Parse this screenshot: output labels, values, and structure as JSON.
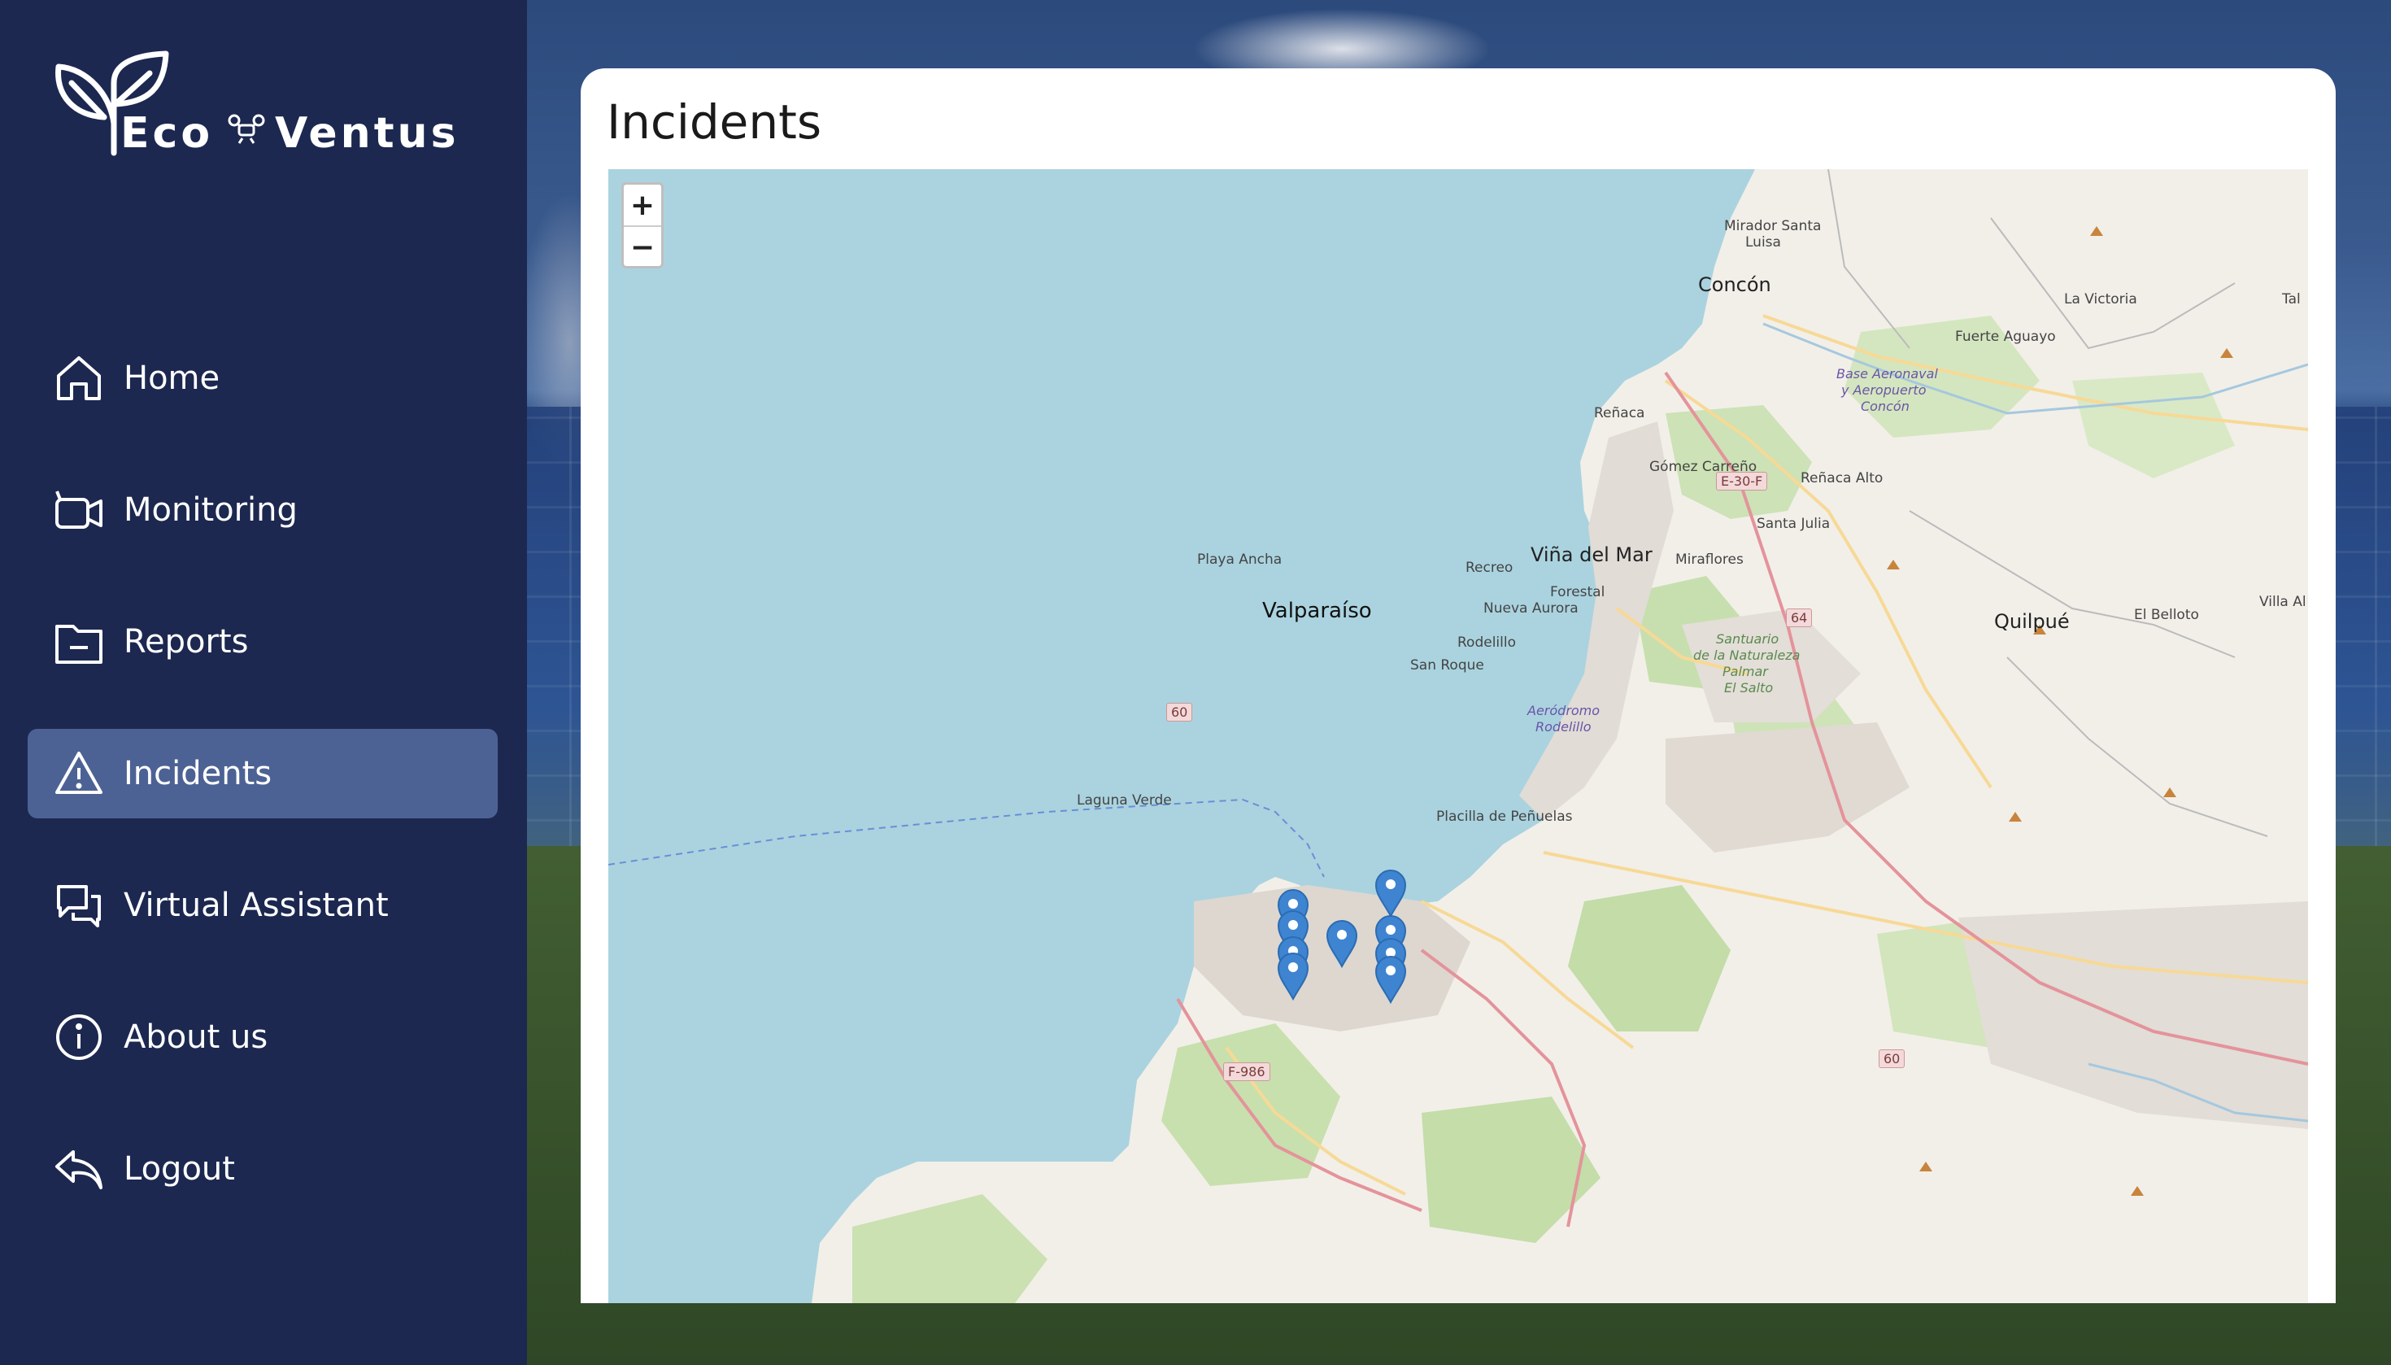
{
  "app": {
    "logo_text_1": "Eco",
    "logo_text_2": "Ventus",
    "accent": "#4d6294",
    "sidebar_bg": "#1c2850"
  },
  "sidebar": {
    "items": [
      {
        "label": "Home",
        "icon": "home-icon",
        "active": false
      },
      {
        "label": "Monitoring",
        "icon": "video-camera-icon",
        "active": false
      },
      {
        "label": "Reports",
        "icon": "folder-icon",
        "active": false
      },
      {
        "label": "Incidents",
        "icon": "warning-icon",
        "active": true
      },
      {
        "label": "Virtual Assistant",
        "icon": "chat-icon",
        "active": false
      },
      {
        "label": "About us",
        "icon": "info-icon",
        "active": false
      },
      {
        "label": "Logout",
        "icon": "logout-icon",
        "active": false
      }
    ]
  },
  "main": {
    "title": "Incidents",
    "map": {
      "zoom_in": "+",
      "zoom_out": "−",
      "labels": {
        "mirador": "Mirador Santa",
        "mirador2": "Luisa",
        "concon": "Concón",
        "la_victoria": "La Victoria",
        "fuerte_aguayo": "Fuerte Aguayo",
        "base_aeronaval": "Base Aeronaval",
        "aeropuerto": "y Aeropuerto",
        "concon2": "Concón",
        "renaca": "Reñaca",
        "gomez_carreno": "Gómez Carreño",
        "renaca_alto": "Reñaca Alto",
        "santa_julia": "Santa Julia",
        "vina_del_mar": "Viña del Mar",
        "miraflores": "Miraflores",
        "recreo": "Recreo",
        "playa_ancha": "Playa Ancha",
        "forestal": "Forestal",
        "valparaiso": "Valparaíso",
        "nueva_aurora": "Nueva Aurora",
        "quilpue": "Quilpué",
        "el_belloto": "El Belloto",
        "villa_al": "Villa Al",
        "rodelillo": "Rodelillo",
        "san_roque": "San Roque",
        "santuario": "Santuario",
        "santuario2": "de la Naturaleza",
        "santuario3": "Palmar",
        "santuario4": "El Salto",
        "aerodromo": "Aeródromo",
        "aerodromo2": "Rodelillo",
        "laguna_verde": "Laguna Verde",
        "placilla": "Placilla de Peñuelas",
        "tal": "Tal"
      },
      "road_signs": {
        "e30f": "E-30-F",
        "r64": "64",
        "r60a": "60",
        "r60b": "60",
        "f986": "F-986"
      }
    }
  }
}
